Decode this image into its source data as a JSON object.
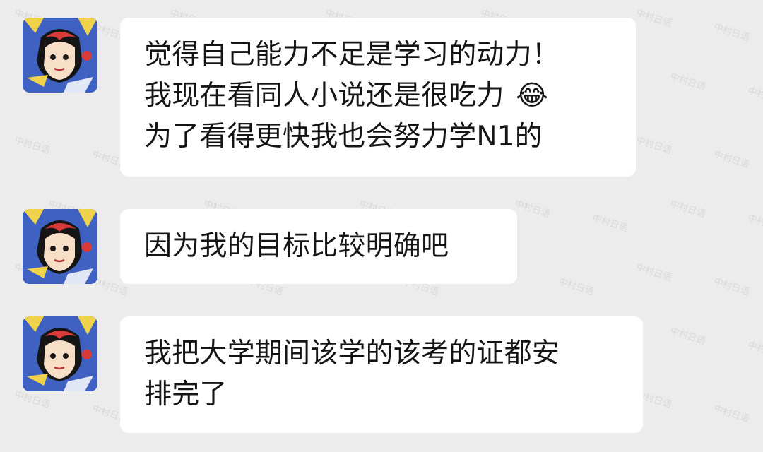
{
  "watermark": "中村日语",
  "colors": {
    "background": "#ececec",
    "bubble": "#ffffff",
    "avatar_bg": "#3f61c2",
    "avatar_accent": "#f0d34a"
  },
  "messages": [
    {
      "lines": [
        "觉得自己能力不足是学习的动力！",
        "我现在看同人小说还是很吃力",
        "为了看得更快我也会努力学N1的"
      ],
      "emoji": "😂",
      "emoji_name": "face-with-tears-of-joy-icon"
    },
    {
      "lines": [
        "因为我的目标比较明确吧"
      ]
    },
    {
      "lines": [
        "我把大学期间该学的该考的证都安",
        "排完了"
      ]
    }
  ]
}
